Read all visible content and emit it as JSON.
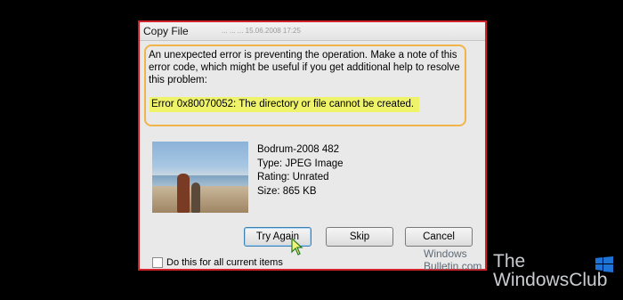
{
  "dialog": {
    "title": "Copy File",
    "title_faint_text": "...   ...   ... 15.06.2008 17:25",
    "message": "An unexpected error is preventing the operation. Make a note of this error code, which might be useful if you get additional help to resolve this problem:",
    "error": "Error 0x80070052: The directory or file cannot be created.",
    "file": {
      "name": "Bodrum-2008 482",
      "type": "Type: JPEG Image",
      "rating": "Rating: Unrated",
      "size": "Size: 865 KB"
    },
    "buttons": {
      "try_again": "Try Again",
      "skip": "Skip",
      "cancel": "Cancel"
    },
    "checkbox_label": "Do this for all current items",
    "checkbox_checked": false
  },
  "watermark": {
    "small_line1": "Windows",
    "small_line2": "Bulletin.com",
    "big_line1": "The",
    "big_line2": "WindowsClub"
  },
  "colors": {
    "dialog_border": "#d2232a",
    "highlight_outline": "#f0b54a",
    "error_highlight": "#eef36a"
  }
}
